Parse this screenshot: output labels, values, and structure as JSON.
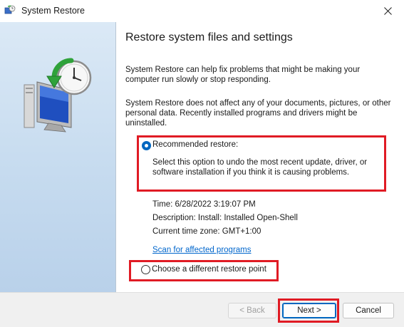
{
  "window": {
    "title": "System Restore",
    "close_glyph": "✕"
  },
  "main": {
    "heading": "Restore system files and settings",
    "paragraph1": "System Restore can help fix problems that might be making your computer run slowly or stop responding.",
    "paragraph2": "System Restore does not affect any of your documents, pictures, or other personal data. Recently installed programs and drivers might be uninstalled."
  },
  "recommended": {
    "label": "Recommended restore:",
    "description": "Select this option to undo the most recent update, driver, or software installation if you think it is causing problems.",
    "selected": true,
    "time": "Time: 6/28/2022 3:19:07 PM",
    "restore_description": "Description: Install: Installed Open-Shell",
    "timezone": "Current time zone: GMT+1:00",
    "scan_link": "Scan for affected programs"
  },
  "choose": {
    "label": "Choose a different restore point",
    "selected": false
  },
  "buttons": {
    "back": "< Back",
    "next": "Next >",
    "cancel": "Cancel"
  },
  "colors": {
    "highlight": "#e01b24",
    "accent": "#0067c0",
    "link": "#0066cc"
  },
  "icons": {
    "app": "system-restore-icon",
    "hero": "computer-clock-restore-icon",
    "close": "close-icon"
  }
}
